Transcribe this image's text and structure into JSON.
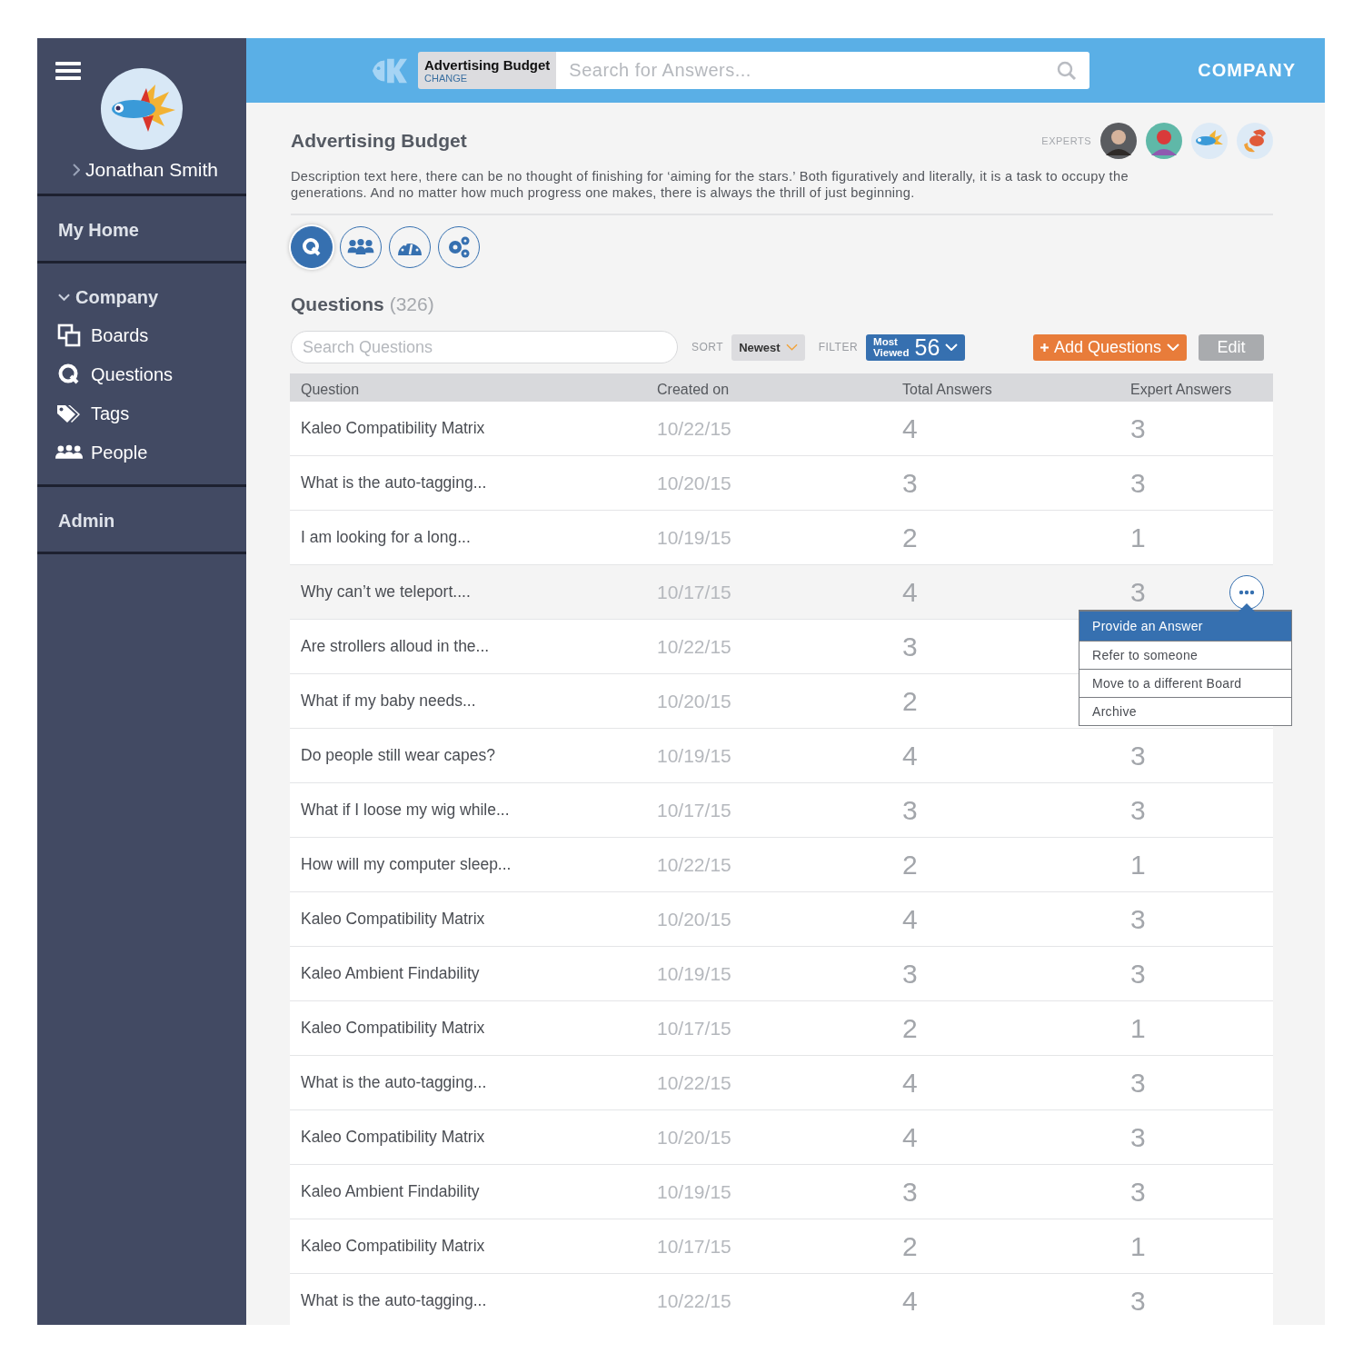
{
  "sidebar": {
    "user": {
      "name": "Jonathan Smith"
    },
    "sections": [
      {
        "label": "My Home",
        "expanded": false
      },
      {
        "label": "Company",
        "expanded": true,
        "children": [
          {
            "label": "Boards",
            "kind": "boards"
          },
          {
            "label": "Questions",
            "kind": "questions"
          },
          {
            "label": "Tags",
            "kind": "tags"
          },
          {
            "label": "People",
            "kind": "people"
          }
        ]
      },
      {
        "label": "Admin",
        "expanded": false
      }
    ]
  },
  "header": {
    "board": {
      "title": "Advertising Budget",
      "action": "CHANGE"
    },
    "search": {
      "placeholder": "Search for Answers..."
    },
    "company": "COMPANY"
  },
  "board": {
    "title": "Advertising Budget",
    "experts_label": "EXPERTS",
    "experts": [
      {
        "kind": "person"
      },
      {
        "kind": "person"
      },
      {
        "kind": "fish"
      },
      {
        "kind": "crab"
      }
    ],
    "description": "Description text here, there can be no thought of finishing for ‘aiming for the stars.’ Both figuratively and literally, it is a task to occupy the generations. And no matter how much progress one makes, there is always the thrill of just beginning.",
    "tabs": [
      {
        "kind": "questions",
        "selected": true
      },
      {
        "kind": "people",
        "selected": false
      },
      {
        "kind": "dashboard",
        "selected": false
      },
      {
        "kind": "settings",
        "selected": false
      }
    ]
  },
  "questions": {
    "title": "Questions",
    "count": "(326)",
    "search": {
      "placeholder": "Search Questions"
    },
    "sort": {
      "label": "SORT",
      "value": "Newest"
    },
    "filter": {
      "label": "FILTER",
      "value_line1": "Most",
      "value_line2": "Viewed",
      "count": "56"
    },
    "add_button": "Add Questions",
    "edit_button": "Edit",
    "columns": [
      "Question",
      "Created on",
      "Total Answers",
      "Expert Answers"
    ],
    "rows": [
      {
        "question": "Kaleo Compatibility Matrix",
        "created": "10/22/15",
        "total": "4",
        "expert": "3",
        "selected": false
      },
      {
        "question": "What is the auto-tagging...",
        "created": "10/20/15",
        "total": "3",
        "expert": "3",
        "selected": false
      },
      {
        "question": "I am looking for a long...",
        "created": "10/19/15",
        "total": "2",
        "expert": "1",
        "selected": false
      },
      {
        "question": "Why can’t we teleport....",
        "created": "10/17/15",
        "total": "4",
        "expert": "3",
        "selected": true
      },
      {
        "question": "Are strollers alloud in the...",
        "created": "10/22/15",
        "total": "3",
        "selected": false
      },
      {
        "question": "What if my baby needs...",
        "created": "10/20/15",
        "total": "2",
        "selected": false
      },
      {
        "question": "Do people still wear capes?",
        "created": "10/19/15",
        "total": "4",
        "expert": "3",
        "selected": false
      },
      {
        "question": "What if I loose my wig while...",
        "created": "10/17/15",
        "total": "3",
        "expert": "3",
        "selected": false
      },
      {
        "question": "How will my computer sleep...",
        "created": "10/22/15",
        "total": "2",
        "expert": "1",
        "selected": false
      },
      {
        "question": "Kaleo Compatibility Matrix",
        "created": "10/20/15",
        "total": "4",
        "expert": "3",
        "selected": false
      },
      {
        "question": "Kaleo Ambient Findability",
        "created": "10/19/15",
        "total": "3",
        "expert": "3",
        "selected": false
      },
      {
        "question": "Kaleo Compatibility Matrix",
        "created": "10/17/15",
        "total": "2",
        "expert": "1",
        "selected": false
      },
      {
        "question": "What is the auto-tagging...",
        "created": "10/22/15",
        "total": "4",
        "expert": "3",
        "selected": false
      },
      {
        "question": "Kaleo Compatibility Matrix",
        "created": "10/20/15",
        "total": "4",
        "expert": "3",
        "selected": false
      },
      {
        "question": "Kaleo Ambient Findability",
        "created": "10/19/15",
        "total": "3",
        "expert": "3",
        "selected": false
      },
      {
        "question": "Kaleo Compatibility Matrix",
        "created": "10/17/15",
        "total": "2",
        "expert": "1",
        "selected": false
      },
      {
        "question": "What is the auto-tagging...",
        "created": "10/22/15",
        "total": "4",
        "expert": "3",
        "selected": false
      }
    ],
    "row_menu": [
      {
        "label": "Provide an Answer",
        "selected": true
      },
      {
        "label": "Refer to someone",
        "selected": false
      },
      {
        "label": "Move to a different Board",
        "selected": false
      },
      {
        "label": "Archive",
        "selected": false
      }
    ]
  }
}
